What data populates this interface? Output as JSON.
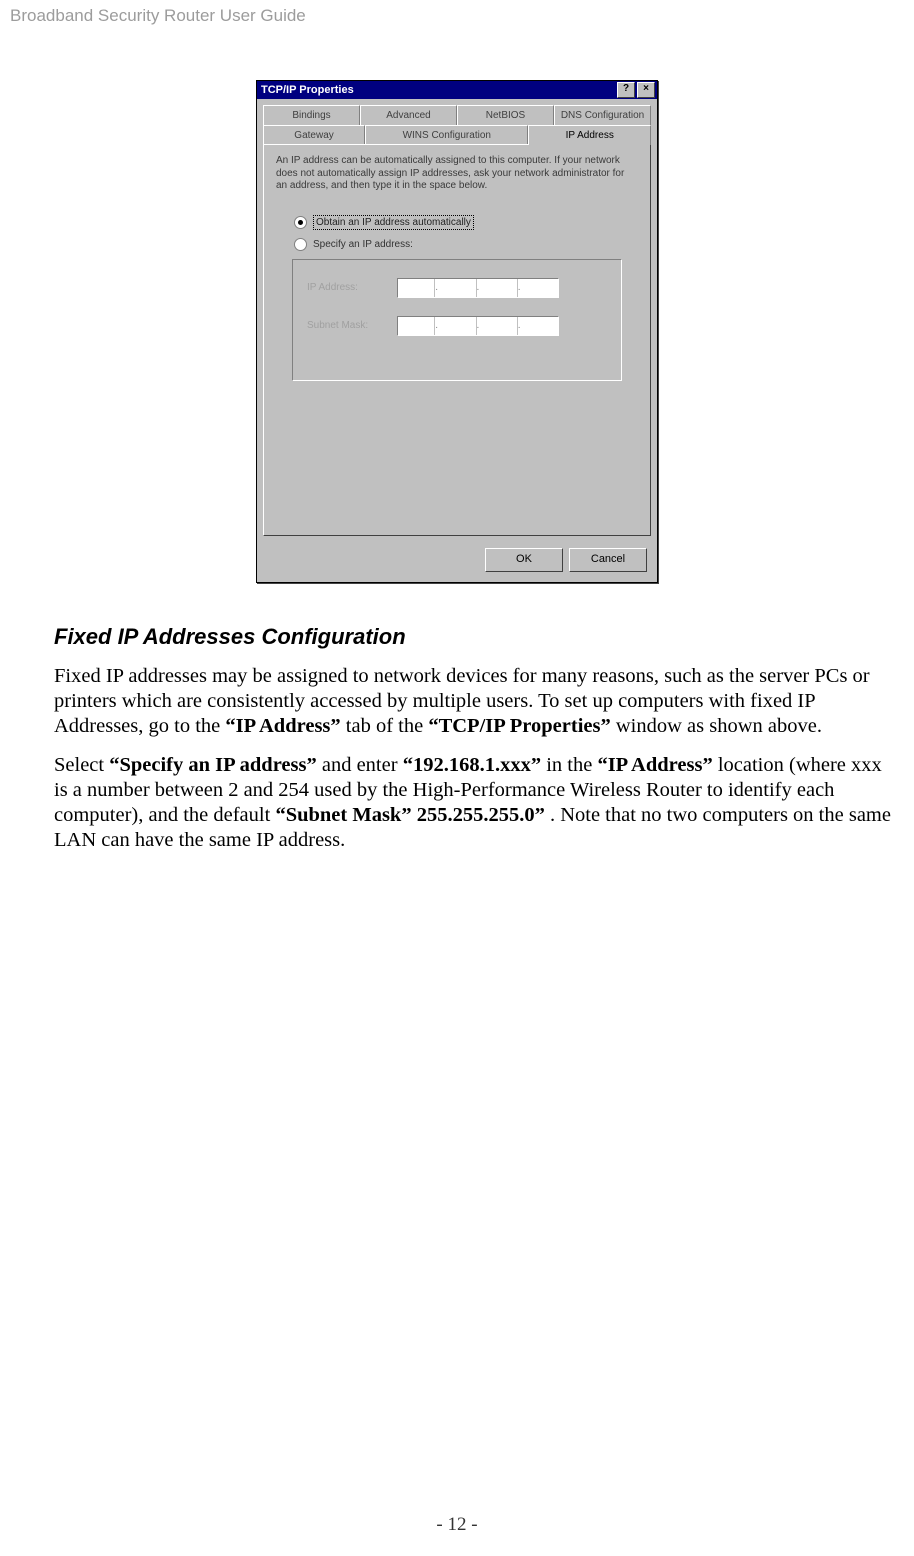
{
  "header": "Broadband Security Router User Guide",
  "page_number": "- 12 -",
  "dialog": {
    "title": "TCP/IP Properties",
    "help_btn": "?",
    "close_btn": "×",
    "tabs_row1": [
      "Bindings",
      "Advanced",
      "NetBIOS",
      "DNS Configuration"
    ],
    "tabs_row2": [
      "Gateway",
      "WINS Configuration",
      "IP Address"
    ],
    "description": "An IP address can be automatically assigned to this computer. If your network does not automatically assign IP addresses, ask your network administrator for an address, and then type it in the space below.",
    "radio_auto": "Obtain an IP address automatically",
    "radio_specify": "Specify an IP address:",
    "label_ip": "IP Address:",
    "label_subnet": "Subnet Mask:",
    "btn_ok": "OK",
    "btn_cancel": "Cancel"
  },
  "section_heading": "Fixed IP Addresses Configuration",
  "para1": {
    "t1": "Fixed IP addresses may be assigned to network devices for many reasons, such as the server PCs or printers which are consistently accessed by multiple users. To set up computers with fixed IP Addresses, go to the ",
    "b1": "“IP Address”",
    "t2": " tab of the ",
    "b2": "“TCP/IP Properties”",
    "t3": " window as shown above."
  },
  "para2": {
    "t1": "Select ",
    "b1": "“Specify an IP address”",
    "t2": " and enter ",
    "b2": "“192.168.1.xxx”",
    "t3": " in the ",
    "b3": "“IP Address”",
    "t4": " location (where xxx is a number between 2 and 254 used by the High-Performance Wireless Router to identify each computer), and the default ",
    "b4": "“Subnet Mask” 255.255.255.0”",
    "t5": ". Note that no two computers on the same LAN can have the same IP address."
  }
}
